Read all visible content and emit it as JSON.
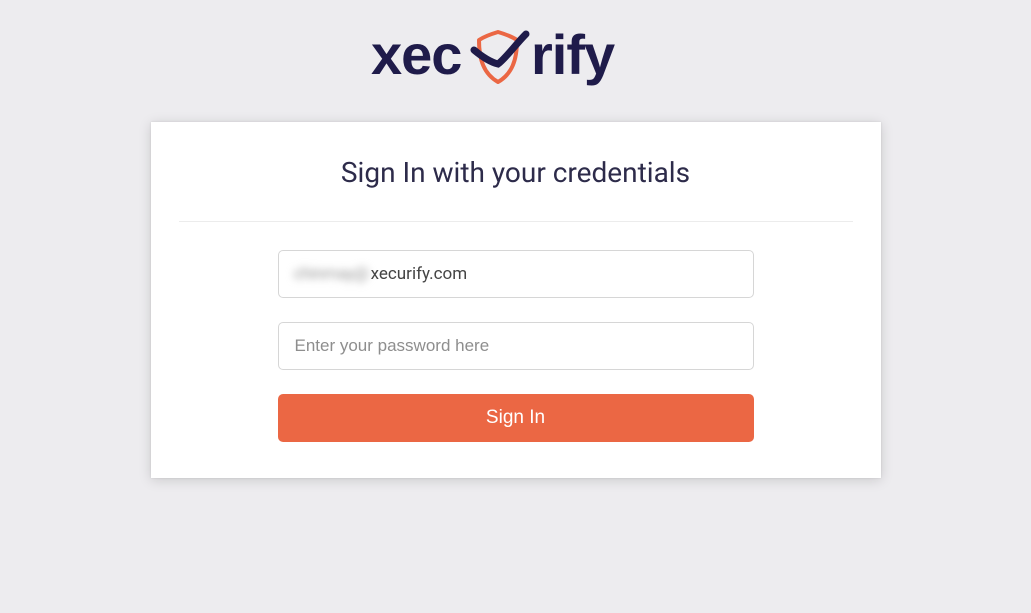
{
  "brand": {
    "name_part1": "xec",
    "name_part2": "rify",
    "text_color": "#1f1b4a",
    "accent_color": "#eb6744"
  },
  "card": {
    "title": "Sign In with your credentials"
  },
  "form": {
    "email_blurred": "chinmay@",
    "email_visible": "xecurify.com",
    "password_placeholder": "Enter your password here",
    "submit_label": "Sign In"
  }
}
